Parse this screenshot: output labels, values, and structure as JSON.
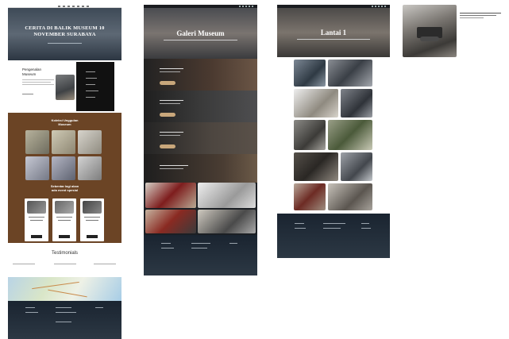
{
  "pages": {
    "home": {
      "hero_title_line1": "CERITA DI BALIK MUSEUM 10",
      "hero_title_line2": "NOVEMBER SURABAYA",
      "intro_heading_line1": "Pengenalan",
      "intro_heading_line2": "Museum",
      "collection_title_line1": "Koleksi Unggulan",
      "collection_title_line2": "Museum",
      "events_title_line1": "Sebentar lagi akan",
      "events_title_line2": "ada event spesial",
      "testimonial_title": "Testimonials"
    },
    "gallery": {
      "hero_title": "Galeri Museum"
    },
    "floor": {
      "hero_title": "Lantai 1"
    },
    "colors": {
      "brown_section": "#6b4425",
      "accent_button": "#c9a77b",
      "dark_footer": "#1a2430",
      "hero_dark": "#2d3036"
    }
  }
}
